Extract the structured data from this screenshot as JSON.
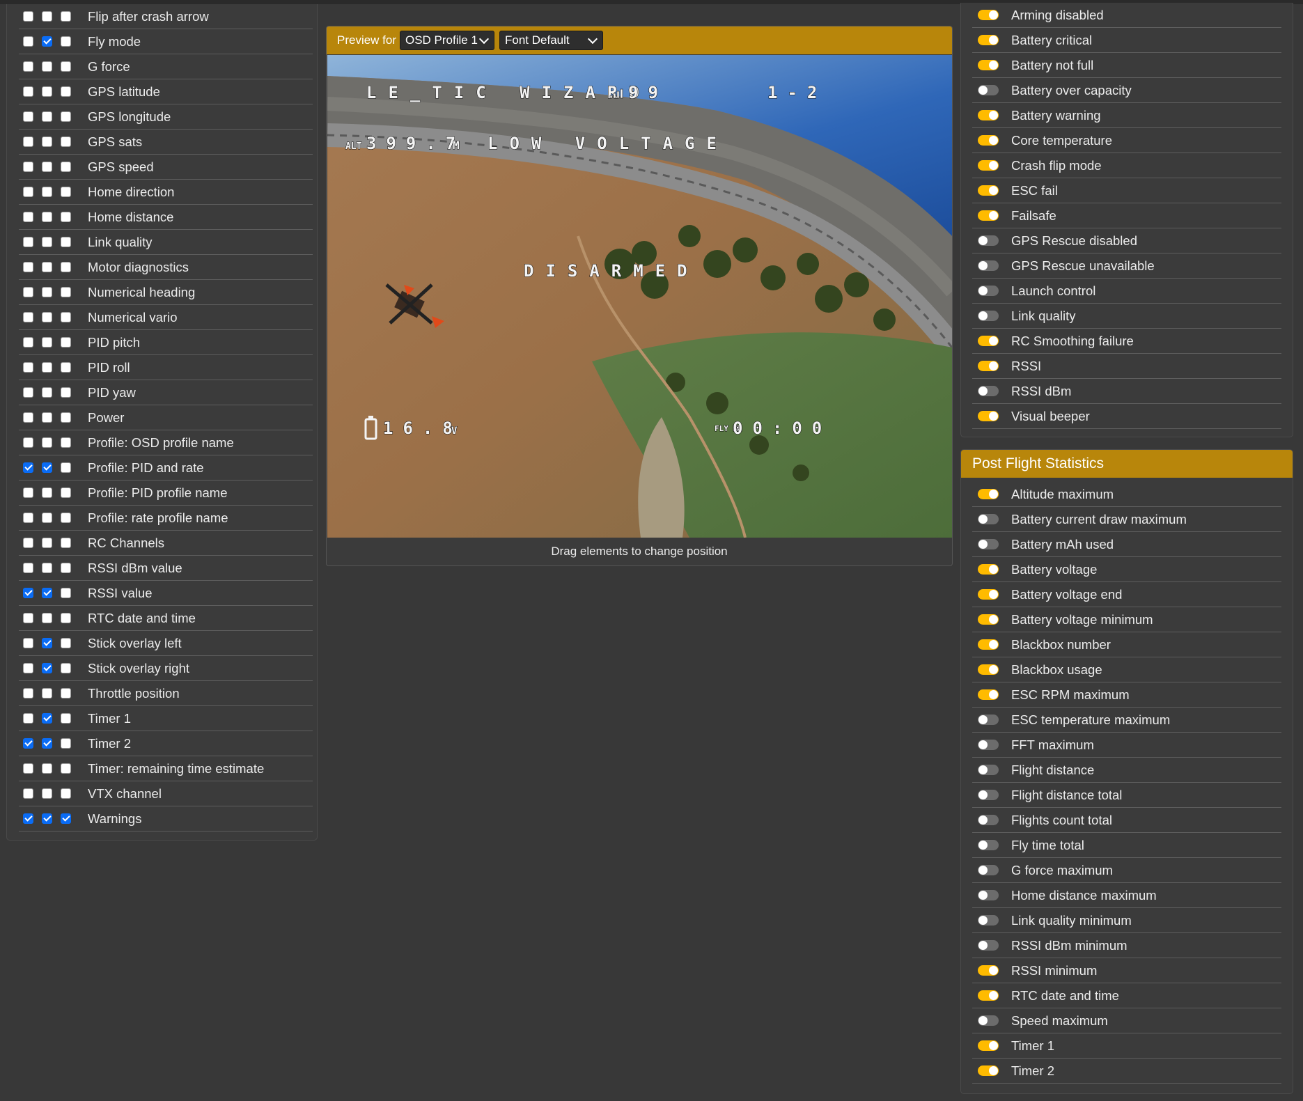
{
  "elements": [
    {
      "label": "Flip after crash arrow",
      "c": [
        false,
        false,
        false
      ]
    },
    {
      "label": "Fly mode",
      "c": [
        false,
        true,
        false
      ]
    },
    {
      "label": "G force",
      "c": [
        false,
        false,
        false
      ]
    },
    {
      "label": "GPS latitude",
      "c": [
        false,
        false,
        false
      ]
    },
    {
      "label": "GPS longitude",
      "c": [
        false,
        false,
        false
      ]
    },
    {
      "label": "GPS sats",
      "c": [
        false,
        false,
        false
      ]
    },
    {
      "label": "GPS speed",
      "c": [
        false,
        false,
        false
      ]
    },
    {
      "label": "Home direction",
      "c": [
        false,
        false,
        false
      ]
    },
    {
      "label": "Home distance",
      "c": [
        false,
        false,
        false
      ]
    },
    {
      "label": "Link quality",
      "c": [
        false,
        false,
        false
      ]
    },
    {
      "label": "Motor diagnostics",
      "c": [
        false,
        false,
        false
      ]
    },
    {
      "label": "Numerical heading",
      "c": [
        false,
        false,
        false
      ]
    },
    {
      "label": "Numerical vario",
      "c": [
        false,
        false,
        false
      ]
    },
    {
      "label": "PID pitch",
      "c": [
        false,
        false,
        false
      ]
    },
    {
      "label": "PID roll",
      "c": [
        false,
        false,
        false
      ]
    },
    {
      "label": "PID yaw",
      "c": [
        false,
        false,
        false
      ]
    },
    {
      "label": "Power",
      "c": [
        false,
        false,
        false
      ]
    },
    {
      "label": "Profile: OSD profile name",
      "c": [
        false,
        false,
        false
      ]
    },
    {
      "label": "Profile: PID and rate",
      "c": [
        true,
        true,
        false
      ]
    },
    {
      "label": "Profile: PID profile name",
      "c": [
        false,
        false,
        false
      ]
    },
    {
      "label": "Profile: rate profile name",
      "c": [
        false,
        false,
        false
      ]
    },
    {
      "label": "RC Channels",
      "c": [
        false,
        false,
        false
      ]
    },
    {
      "label": "RSSI dBm value",
      "c": [
        false,
        false,
        false
      ]
    },
    {
      "label": "RSSI value",
      "c": [
        true,
        true,
        false
      ]
    },
    {
      "label": "RTC date and time",
      "c": [
        false,
        false,
        false
      ]
    },
    {
      "label": "Stick overlay left",
      "c": [
        false,
        true,
        false
      ]
    },
    {
      "label": "Stick overlay right",
      "c": [
        false,
        true,
        false
      ]
    },
    {
      "label": "Throttle position",
      "c": [
        false,
        false,
        false
      ]
    },
    {
      "label": "Timer 1",
      "c": [
        false,
        true,
        false
      ]
    },
    {
      "label": "Timer 2",
      "c": [
        true,
        true,
        false
      ]
    },
    {
      "label": "Timer: remaining time estimate",
      "c": [
        false,
        false,
        false
      ]
    },
    {
      "label": "VTX channel",
      "c": [
        false,
        false,
        false
      ]
    },
    {
      "label": "Warnings",
      "c": [
        true,
        true,
        true
      ]
    }
  ],
  "preview": {
    "label": "Preview for",
    "profile": "OSD Profile 1",
    "font": "Font Default",
    "hint": "Drag elements to change position"
  },
  "osd": {
    "craft_name": "LE_TIC WIZARD",
    "rssi": "99",
    "pid_rate": "1-2",
    "alt_label": "ALT",
    "altitude": "399.7",
    "alt_unit": "M",
    "warning": "LOW VOLTAGE",
    "status": "DISARMED",
    "voltage": "16.8",
    "volt_unit": "V",
    "fly_label": "FLY MN",
    "timer": "00:00"
  },
  "warnings": [
    {
      "label": "Arming disabled",
      "on": true
    },
    {
      "label": "Battery critical",
      "on": true
    },
    {
      "label": "Battery not full",
      "on": true
    },
    {
      "label": "Battery over capacity",
      "on": false
    },
    {
      "label": "Battery warning",
      "on": true
    },
    {
      "label": "Core temperature",
      "on": true
    },
    {
      "label": "Crash flip mode",
      "on": true
    },
    {
      "label": "ESC fail",
      "on": true
    },
    {
      "label": "Failsafe",
      "on": true
    },
    {
      "label": "GPS Rescue disabled",
      "on": false
    },
    {
      "label": "GPS Rescue unavailable",
      "on": false
    },
    {
      "label": "Launch control",
      "on": false
    },
    {
      "label": "Link quality",
      "on": false
    },
    {
      "label": "RC Smoothing failure",
      "on": true
    },
    {
      "label": "RSSI",
      "on": true
    },
    {
      "label": "RSSI dBm",
      "on": false
    },
    {
      "label": "Visual beeper",
      "on": true
    }
  ],
  "stats": {
    "title": "Post Flight Statistics",
    "items": [
      {
        "label": "Altitude maximum",
        "on": true
      },
      {
        "label": "Battery current draw maximum",
        "on": false
      },
      {
        "label": "Battery mAh used",
        "on": false
      },
      {
        "label": "Battery voltage",
        "on": true
      },
      {
        "label": "Battery voltage end",
        "on": true
      },
      {
        "label": "Battery voltage minimum",
        "on": true
      },
      {
        "label": "Blackbox number",
        "on": true
      },
      {
        "label": "Blackbox usage",
        "on": true
      },
      {
        "label": "ESC RPM maximum",
        "on": true
      },
      {
        "label": "ESC temperature maximum",
        "on": false
      },
      {
        "label": "FFT maximum",
        "on": false
      },
      {
        "label": "Flight distance",
        "on": false
      },
      {
        "label": "Flight distance total",
        "on": false
      },
      {
        "label": "Flights count total",
        "on": false
      },
      {
        "label": "Fly time total",
        "on": false
      },
      {
        "label": "G force maximum",
        "on": false
      },
      {
        "label": "Home distance maximum",
        "on": false
      },
      {
        "label": "Link quality minimum",
        "on": false
      },
      {
        "label": "RSSI dBm minimum",
        "on": false
      },
      {
        "label": "RSSI minimum",
        "on": true
      },
      {
        "label": "RTC date and time",
        "on": true
      },
      {
        "label": "Speed maximum",
        "on": false
      },
      {
        "label": "Timer 1",
        "on": true
      },
      {
        "label": "Timer 2",
        "on": true
      }
    ]
  },
  "colors": {
    "accent": "#b8860b",
    "toggle_on": "#ffbb00",
    "checkbox_on": "#0a6cf5",
    "background": "#383838"
  }
}
